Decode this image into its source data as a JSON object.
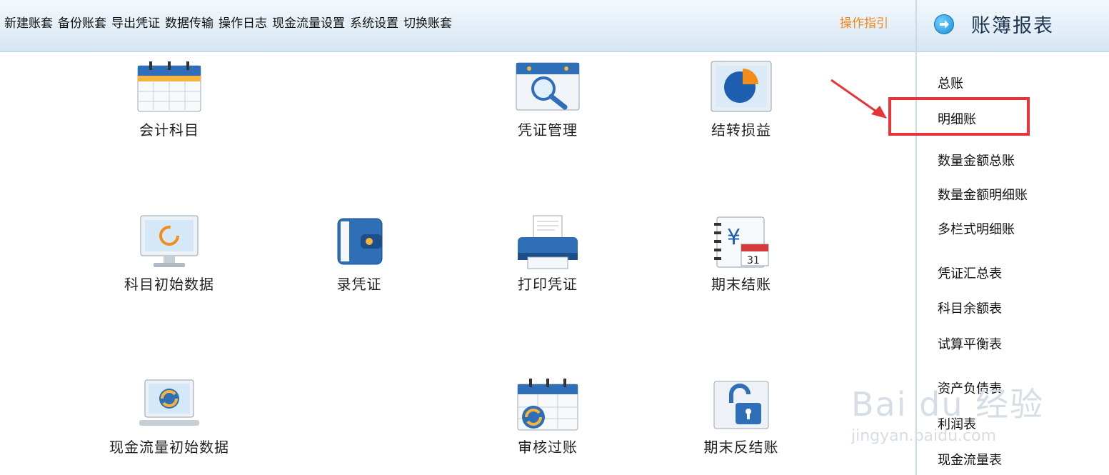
{
  "toolbar": {
    "menu": [
      "新建账套",
      "备份账套",
      "导出凭证",
      "数据传输",
      "操作日志",
      "现金流量设置",
      "系统设置",
      "切换账套"
    ],
    "guide": "操作指引"
  },
  "right_panel": {
    "title": "账簿报表",
    "items": [
      "总账",
      "明细账",
      "数量金额总账",
      "数量金额明细账",
      "多栏式明细账",
      "凭证汇总表",
      "科目余额表",
      "试算平衡表",
      "资产负债表",
      "利润表",
      "现金流量表"
    ],
    "selected": "明细账"
  },
  "tiles": [
    {
      "label": "会计科目",
      "icon": "calendar-icon"
    },
    {
      "label": "凭证管理",
      "icon": "magnifier-icon"
    },
    {
      "label": "结转损益",
      "icon": "pie-chart-icon"
    },
    {
      "label": "科目初始数据",
      "icon": "monitor-icon"
    },
    {
      "label": "录凭证",
      "icon": "wallet-icon"
    },
    {
      "label": "打印凭证",
      "icon": "printer-icon"
    },
    {
      "label": "期末结账",
      "icon": "ledger-calendar-icon"
    },
    {
      "label": "现金流量初始数据",
      "icon": "laptop-refresh-icon"
    },
    {
      "label": "审核过账",
      "icon": "calendar-refresh-icon"
    },
    {
      "label": "期末反结账",
      "icon": "unlock-icon"
    }
  ],
  "watermark": {
    "brand": "Bai du 经验",
    "url": "jingyan.baidu.com"
  },
  "colors": {
    "accent": "#f08a1a",
    "highlight": "#e5353a",
    "toolbar_bg": "#e2edf7"
  }
}
